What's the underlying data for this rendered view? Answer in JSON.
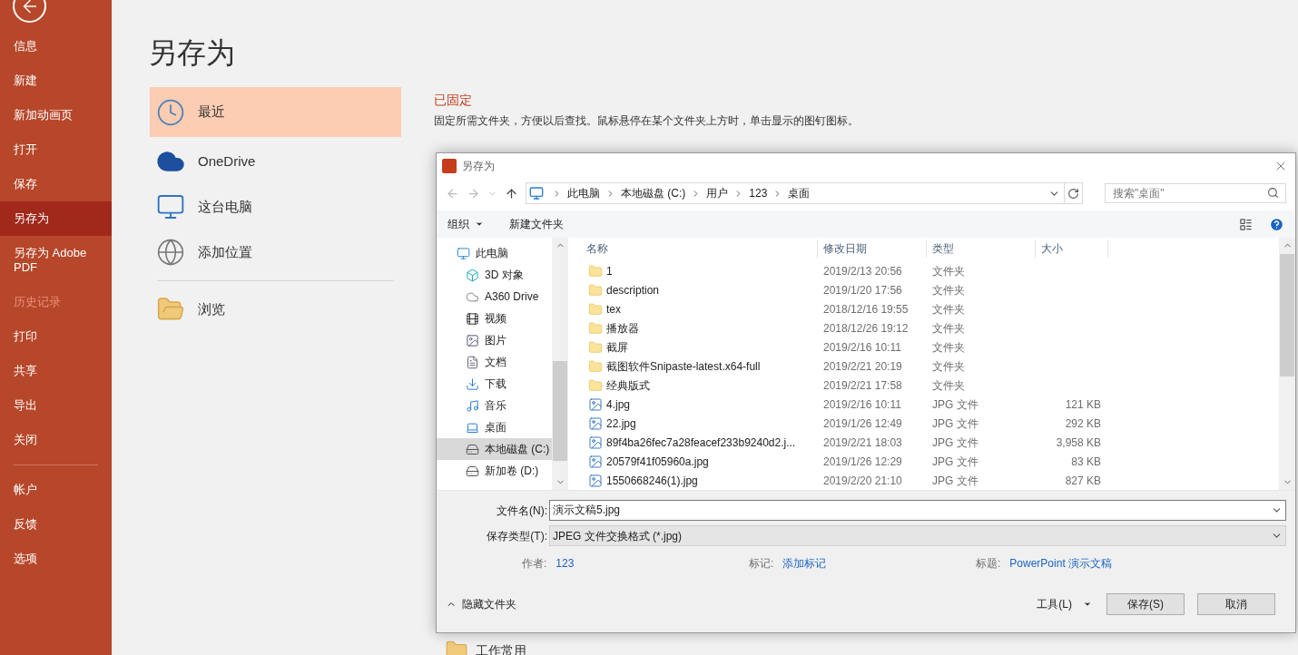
{
  "sidebar": {
    "items": [
      {
        "label": "信息",
        "selected": false,
        "disabled": false
      },
      {
        "label": "新建",
        "selected": false,
        "disabled": false
      },
      {
        "label": "新加动画页",
        "selected": false,
        "disabled": false
      },
      {
        "label": "打开",
        "selected": false,
        "disabled": false
      },
      {
        "label": "保存",
        "selected": false,
        "disabled": false
      },
      {
        "label": "另存为",
        "selected": true,
        "disabled": false
      },
      {
        "label": "另存为 Adobe PDF",
        "selected": false,
        "disabled": false
      },
      {
        "label": "历史记录",
        "selected": false,
        "disabled": true
      },
      {
        "label": "打印",
        "selected": false,
        "disabled": false
      },
      {
        "label": "共享",
        "selected": false,
        "disabled": false
      },
      {
        "label": "导出",
        "selected": false,
        "disabled": false
      },
      {
        "label": "关闭",
        "selected": false,
        "disabled": false
      }
    ],
    "bottom_items": [
      {
        "label": "帐户",
        "selected": false,
        "disabled": false
      },
      {
        "label": "反馈",
        "selected": false,
        "disabled": false
      },
      {
        "label": "选项",
        "selected": false,
        "disabled": false
      }
    ]
  },
  "page_title": "另存为",
  "locations": [
    {
      "kind": "recent",
      "label": "最近",
      "selected": true
    },
    {
      "kind": "cloud",
      "label": "OneDrive",
      "selected": false
    },
    {
      "kind": "computer",
      "label": "这台电脑",
      "selected": false
    },
    {
      "kind": "add",
      "label": "添加位置",
      "selected": false
    },
    {
      "kind": "browse",
      "label": "浏览",
      "selected": false
    }
  ],
  "pinned": {
    "heading": "已固定",
    "hint": "固定所需文件夹，方便以后查找。鼠标悬停在某个文件夹上方时，单击显示的图钉图标。"
  },
  "older_folder": "工作常用",
  "dialog": {
    "title": "另存为",
    "breadcrumb": [
      "此电脑",
      "本地磁盘 (C:)",
      "用户",
      "123",
      "桌面"
    ],
    "search": {
      "placeholder": "搜索\"桌面\""
    },
    "toolbar": {
      "organize": "组织",
      "new_folder": "新建文件夹"
    },
    "nav": [
      {
        "kind": "pc",
        "label": "此电脑",
        "selected": false,
        "children": [
          {
            "kind": "cube",
            "label": "3D 对象",
            "selected": false
          },
          {
            "kind": "cloud",
            "label": "A360 Drive",
            "selected": false
          },
          {
            "kind": "video",
            "label": "视频",
            "selected": false
          },
          {
            "kind": "picture",
            "label": "图片",
            "selected": false
          },
          {
            "kind": "document",
            "label": "文档",
            "selected": false
          },
          {
            "kind": "download",
            "label": "下载",
            "selected": false
          },
          {
            "kind": "music",
            "label": "音乐",
            "selected": false
          },
          {
            "kind": "desktop",
            "label": "桌面",
            "selected": false
          },
          {
            "kind": "system",
            "label": "本地磁盘 (C:)",
            "selected": true
          },
          {
            "kind": "drive",
            "label": "新加卷 (D:)",
            "selected": false
          }
        ]
      }
    ],
    "columns": [
      "名称",
      "修改日期",
      "类型",
      "大小"
    ],
    "files": [
      {
        "kind": "folder",
        "name": "1",
        "date": "2019/2/13 20:56",
        "type": "文件夹"
      },
      {
        "kind": "folder",
        "name": "description",
        "date": "2019/1/20 17:56",
        "type": "文件夹"
      },
      {
        "kind": "folder",
        "name": "tex",
        "date": "2018/12/16 19:55",
        "type": "文件夹"
      },
      {
        "kind": "folder",
        "name": "播放器",
        "date": "2018/12/26 19:12",
        "type": "文件夹"
      },
      {
        "kind": "folder",
        "name": "截屏",
        "date": "2019/2/16 10:11",
        "type": "文件夹"
      },
      {
        "kind": "folder",
        "name": "截图软件Snipaste-latest.x64-full",
        "date": "2019/2/21 20:19",
        "type": "文件夹"
      },
      {
        "kind": "folder",
        "name": "经典版式",
        "date": "2019/2/21 17:58",
        "type": "文件夹"
      },
      {
        "kind": "image",
        "name": "4.jpg",
        "date": "2019/2/16 10:11",
        "type": "JPG 文件",
        "size": "121 KB"
      },
      {
        "kind": "image",
        "name": "22.jpg",
        "date": "2019/1/26 12:49",
        "type": "JPG 文件",
        "size": "292 KB"
      },
      {
        "kind": "image",
        "name": "89f4ba26fec7a28feacef233b9240d2.j...",
        "date": "2019/2/21 18:03",
        "type": "JPG 文件",
        "size": "3,958 KB"
      },
      {
        "kind": "image",
        "name": "20579f41f05960a.jpg",
        "date": "2019/1/26 12:29",
        "type": "JPG 文件",
        "size": "83 KB"
      },
      {
        "kind": "image",
        "name": "1550668246(1).jpg",
        "date": "2019/2/20 21:10",
        "type": "JPG 文件",
        "size": "827 KB"
      }
    ],
    "filename": {
      "label": "文件名(N):",
      "value": "演示文稿5.jpg"
    },
    "filetype": {
      "label": "保存类型(T):",
      "value": "JPEG 文件交换格式 (*.jpg)"
    },
    "meta": [
      {
        "label": "作者:",
        "value": "123"
      },
      {
        "label": "标记:",
        "value": "添加标记"
      },
      {
        "label": "标题:",
        "value": "PowerPoint 演示文稿"
      }
    ],
    "hide_folders": "隐藏文件夹",
    "tools": "工具(L)",
    "save": "保存(S)",
    "cancel": "取消"
  }
}
